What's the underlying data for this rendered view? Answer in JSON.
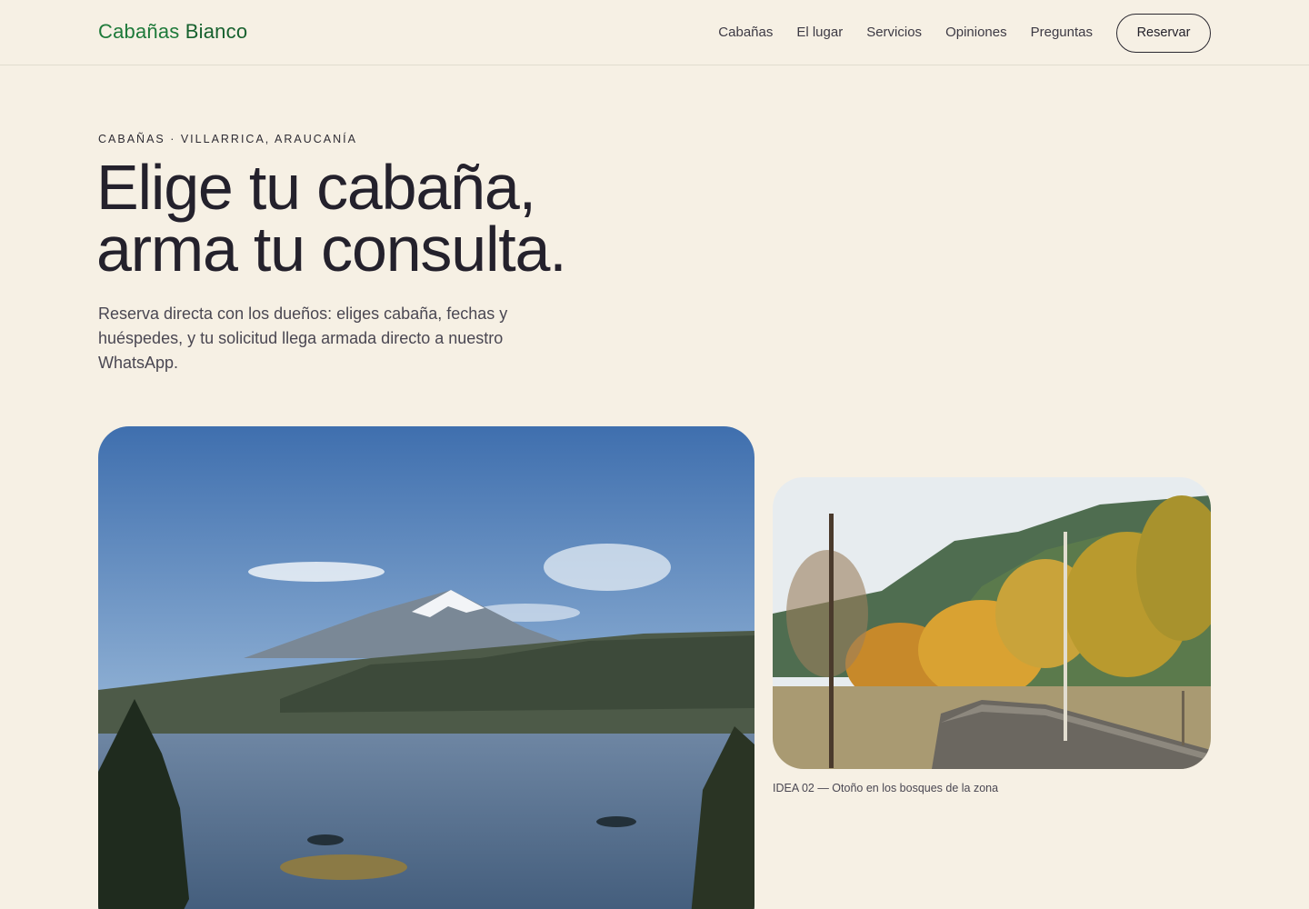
{
  "header": {
    "brand_part1": "Cabañas",
    "brand_part2": "Bianco",
    "nav": [
      "Cabañas",
      "El lugar",
      "Servicios",
      "Opiniones",
      "Preguntas"
    ],
    "cta_label": "Reservar"
  },
  "hero": {
    "eyebrow": "CABAÑAS · VILLARRICA, ARAUCANÍA",
    "title_line1": "Elige tu cabaña,",
    "title_line2": "arma tu consulta.",
    "subtitle": "Reserva directa con los dueños: eliges cabaña, fechas y huéspedes, y tu solicitud llega armada directo a nuestro WhatsApp."
  },
  "gallery": {
    "side_caption": "IDEA 02 — Otoño en los bosques de la zona"
  },
  "colors": {
    "background": "#f6f0e4",
    "brand": "#1e7a3a",
    "text": "#24222b"
  }
}
